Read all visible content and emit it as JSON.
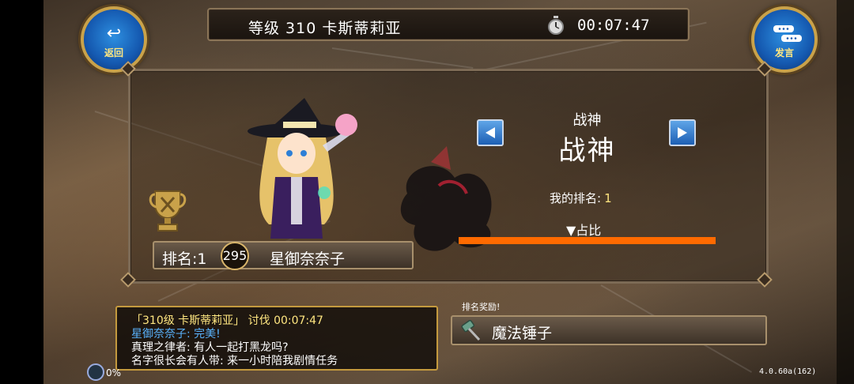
{
  "top_bar": {
    "title": "等级 310 卡斯蒂莉亚",
    "timer": "00:07:47",
    "timer_icon": "stopwatch-icon"
  },
  "buttons": {
    "back_label": "返回",
    "back_icon": "return-arrow-icon",
    "say_label": "发言",
    "say_icon": "chat-bubble-icon"
  },
  "ranking": {
    "rank_text": "排名:1",
    "level": "295",
    "player_name": "星御奈奈子",
    "category_small": "战神",
    "category_large": "战神",
    "my_rank_label": "我的排名:",
    "my_rank_value": "1",
    "share_label": "▼占比",
    "share_fraction": 1.0
  },
  "chat": {
    "lines": [
      {
        "text": "「310级 卡斯蒂莉亚」 讨伐 00:07:47",
        "color": "#ffe680"
      },
      {
        "text": "星御奈奈子: 完美!",
        "color": "#5ab4ff"
      },
      {
        "text": "真理之律者: 有人一起打黑龙吗?",
        "color": "#ffffff"
      },
      {
        "text": "名字很长会有人带: 来一小时陪我剧情任务",
        "color": "#ffffff"
      }
    ]
  },
  "reward": {
    "label": "排名奖励!",
    "item_name": "魔法锤子",
    "item_icon": "hammer-icon"
  },
  "status": {
    "network_percent": "0%",
    "version": "4.0.60a(162)"
  },
  "colors": {
    "accent_gold": "#c49a3e",
    "progress_orange": "#ff6a00",
    "button_blue": "#1559b0"
  }
}
